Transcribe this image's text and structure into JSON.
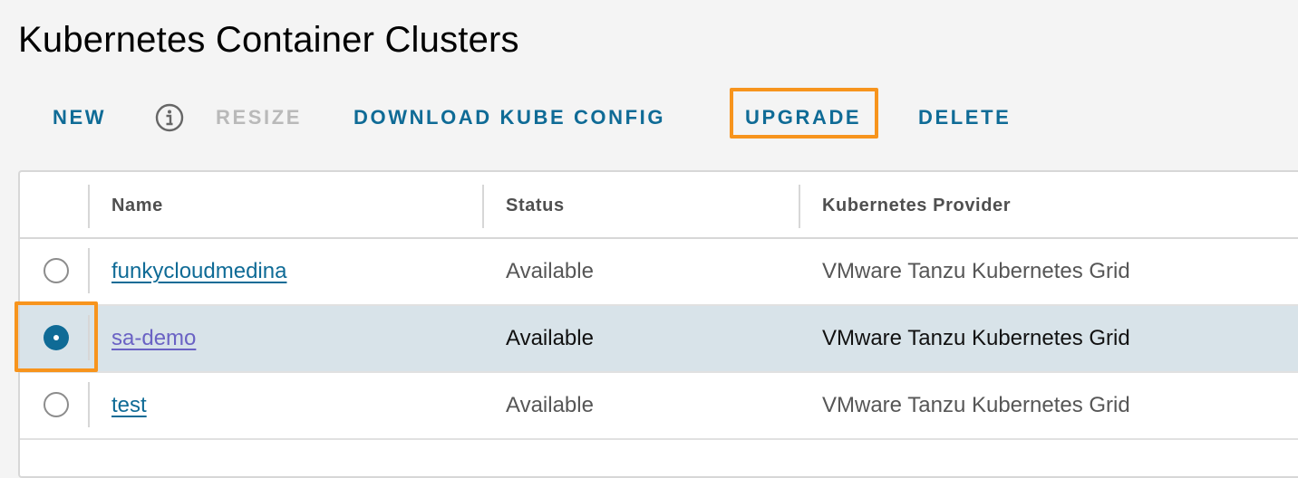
{
  "page": {
    "title": "Kubernetes Container Clusters"
  },
  "toolbar": {
    "new_label": "NEW",
    "info_icon": "info-circle-icon",
    "resize_label": "RESIZE",
    "download_label": "DOWNLOAD KUBE CONFIG",
    "upgrade_label": "UPGRADE",
    "delete_label": "DELETE"
  },
  "table": {
    "columns": [
      "Name",
      "Status",
      "Kubernetes Provider"
    ],
    "rows": [
      {
        "name": "funkycloudmedina",
        "status": "Available",
        "provider": "VMware Tanzu Kubernetes Grid",
        "selected": false
      },
      {
        "name": "sa-demo",
        "status": "Available",
        "provider": "VMware Tanzu Kubernetes Grid",
        "selected": true
      },
      {
        "name": "test",
        "status": "Available",
        "provider": "VMware Tanzu Kubernetes Grid",
        "selected": false
      }
    ]
  },
  "colors": {
    "accent": "#0f6b96",
    "highlight": "#f7941d",
    "selected_row": "#d8e3e9",
    "visited_link": "#6a62c4",
    "disabled": "#b9b9b9"
  }
}
